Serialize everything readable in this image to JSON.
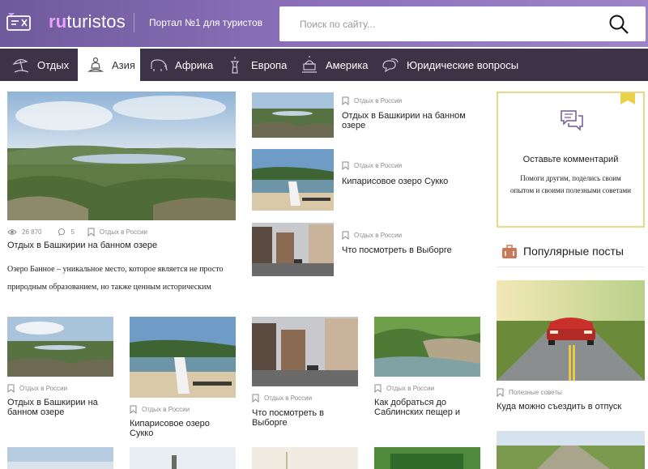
{
  "header": {
    "logo_prefix": "ru",
    "logo_suffix": "turistos",
    "tagline": "Портал №1 для туристов",
    "search_placeholder": "Поиск по сайту...",
    "colors": {
      "gradient_start": "#6f5a9b",
      "gradient_end": "#9d84c6",
      "logo_accent": "#e8a4ff"
    }
  },
  "nav": {
    "items": [
      {
        "label": "Отдых",
        "icon": "beach-umbrella-icon"
      },
      {
        "label": "Азия",
        "icon": "buddha-icon",
        "active": true
      },
      {
        "label": "Африка",
        "icon": "elephant-icon"
      },
      {
        "label": "Европа",
        "icon": "tower-icon"
      },
      {
        "label": "Америка",
        "icon": "capitol-icon"
      },
      {
        "label": "Юридические вопросы",
        "icon": "chat-icon"
      }
    ]
  },
  "featured": {
    "views": "26 870",
    "comments": "5",
    "category": "Отдых в России",
    "title": "Отдых в Башкирии на банном озере",
    "lead": "Озеро Банное – уникальное место, которое является не просто природным образованием, но также ценным историческим"
  },
  "side_list": [
    {
      "category": "Отдых в России",
      "title": "Отдых в Башкирии на банном озере"
    },
    {
      "category": "Отдых в России",
      "title": "Кипарисовое озеро Сукко"
    },
    {
      "category": "Отдых в России",
      "title": "Что посмотреть в Выборге"
    }
  ],
  "grid": [
    {
      "category": "Отдых в России",
      "title": "Отдых в Башкирии на банном озере"
    },
    {
      "category": "Отдых в России",
      "title": "Кипарисовое озеро Сукко"
    },
    {
      "category": "Отдых в России",
      "title": "Что посмотреть в Выборге"
    },
    {
      "category": "Отдых в России",
      "title": "Как добраться до Саблинских пещер и"
    }
  ],
  "comment_widget": {
    "title": "Оставьте комментарий",
    "text": "Помоги другим, поделись своим опытом и своими полезными советами"
  },
  "popular": {
    "title": "Популярные посты",
    "post": {
      "category": "Полезные советы",
      "title": "Куда можно съездить в отпуск"
    }
  }
}
